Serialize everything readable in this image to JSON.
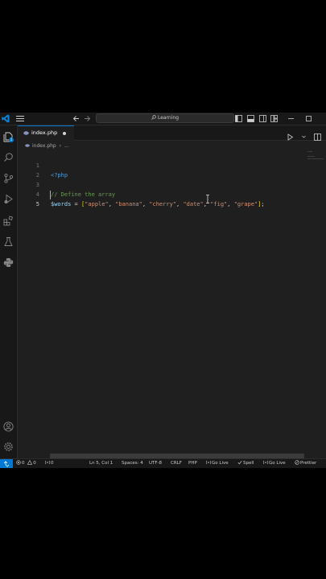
{
  "titlebar": {
    "search_label": "Learning"
  },
  "activity_bar": {
    "explorer_badge": "1"
  },
  "tabs": [
    {
      "label": "index.php",
      "dirty": true
    }
  ],
  "breadcrumb": {
    "file": "index.php",
    "separator": "›",
    "more": "..."
  },
  "editor": {
    "lines": [
      {
        "number": "1",
        "code": "<?php"
      },
      {
        "number": "2",
        "code": ""
      },
      {
        "number": "3",
        "code": "// Define the array"
      },
      {
        "number": "4",
        "code": "$words = [\"apple\", \"banana\", \"cherry\", \"date\", \"fig\", \"grape\"];"
      },
      {
        "number": "5",
        "code": ""
      }
    ],
    "current_line": "5"
  },
  "statusbar": {
    "errors": "0",
    "warnings": "0",
    "ports": "0",
    "position": "Ln 5, Col 1",
    "spaces": "Spaces: 4",
    "encoding": "UTF-8",
    "eol": "CRLF",
    "language": "PHP",
    "go_live_1": "Go Live",
    "spell": "Spell",
    "go_live_2": "Go Live",
    "prettier": "Prettier"
  },
  "colors": {
    "accent": "#0078d4",
    "editor_bg": "#1f1f1f",
    "chrome_bg": "#181818"
  }
}
